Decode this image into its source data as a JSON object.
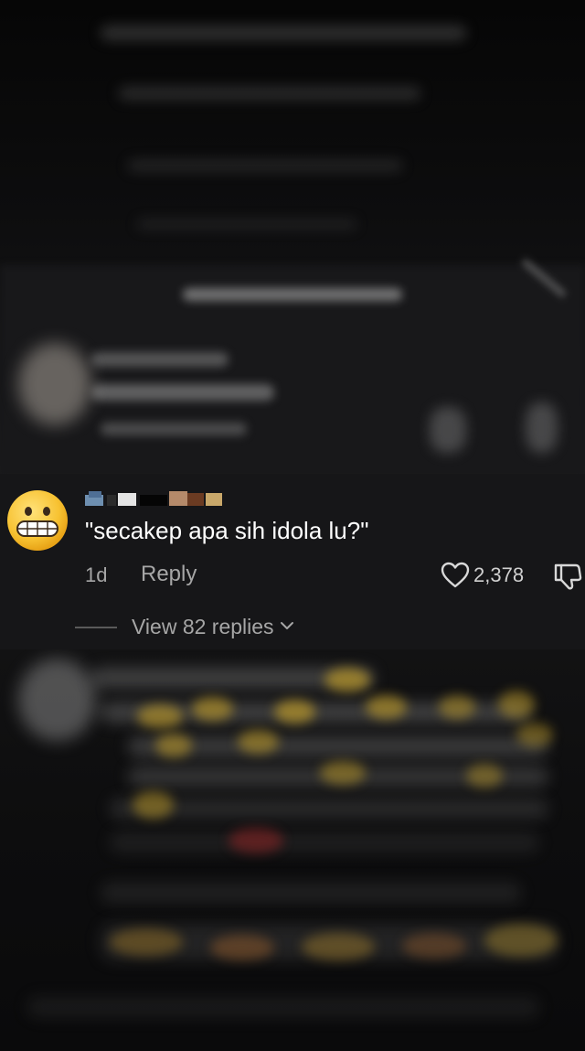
{
  "comment": {
    "avatar_icon": "grimacing-face-emoji-icon",
    "text": "\"secakep apa sih idola lu?\"",
    "time": "1d",
    "reply_label": "Reply",
    "like_count": "2,378",
    "like_icon": "heart-outline-icon",
    "dislike_icon": "thumbs-down-outline-icon"
  },
  "replies": {
    "label": "View 82 replies",
    "icon": "chevron-down-icon"
  },
  "colors": {
    "card_background": "#161618",
    "text_primary": "#ffffff",
    "text_secondary": "#a6a6a6"
  }
}
